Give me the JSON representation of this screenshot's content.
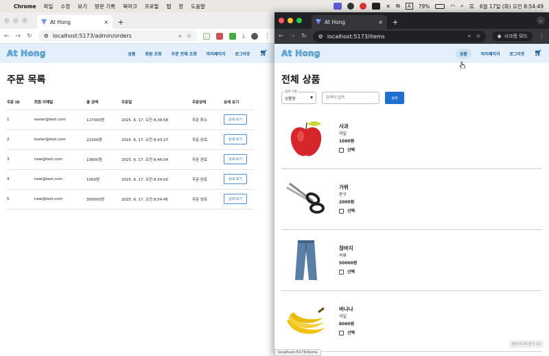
{
  "menubar": {
    "app_name": "Chrome",
    "items": [
      "파일",
      "수정",
      "보기",
      "방문 기록",
      "북마크",
      "프로필",
      "탭",
      "창",
      "도움말"
    ],
    "battery": "79%",
    "datetime": "6월 17일 (화) 오전 8:54:49"
  },
  "left_window": {
    "tab_title": "At Hong",
    "url": "localhost:5173/admin/orders"
  },
  "right_window": {
    "tab_title": "At Hong",
    "url": "localhost:5173/items",
    "incognito_label": "시크릿 모드",
    "status_url": "localhost:5173/items",
    "faded_button": "장바구니에 담기 (0)"
  },
  "site": {
    "logo": "At Hong",
    "nav": [
      "상품",
      "회원 조회",
      "주문 전체 조회",
      "마이페이지",
      "로그아웃"
    ],
    "nav_right": [
      "상품",
      "마이페이지",
      "로그아웃"
    ]
  },
  "orders": {
    "title": "주문 목록",
    "columns": [
      "주문 ID",
      "회원 이메일",
      "총 금액",
      "주문일",
      "주문상태",
      "상세 보기"
    ],
    "detail_label": "상세 보기",
    "rows": [
      {
        "id": "1",
        "email": "tester@test.com",
        "amount": "127000원",
        "date": "2025. 6. 17. 오전 8:39:58",
        "status": "주문 취소"
      },
      {
        "id": "2",
        "email": "tester@test.com",
        "amount": "22200원",
        "date": "2025. 6. 17. 오전 8:43:27",
        "status": "주문 완료"
      },
      {
        "id": "3",
        "email": "new@test.com",
        "amount": "10800원",
        "date": "2025. 6. 17. 오전 8:46:04",
        "status": "주문 완료"
      },
      {
        "id": "4",
        "email": "new@test.com",
        "amount": "1000원",
        "date": "2025. 6. 17. 오전 8:54:00",
        "status": "주문 완료"
      },
      {
        "id": "5",
        "email": "new@test.com",
        "amount": "350000원",
        "date": "2025. 6. 17. 오전 8:54:45",
        "status": "주문 완료"
      }
    ]
  },
  "items": {
    "title": "전체 상품",
    "search_criteria_label": "검색 기준",
    "search_criteria_value": "상품명",
    "search_placeholder": "검색어 입력",
    "search_button": "검색",
    "select_label": "선택",
    "list": [
      {
        "name": "사과",
        "category": "과일",
        "price": "1000원",
        "icon": "apple"
      },
      {
        "name": "가위",
        "category": "문구",
        "price": "2000원",
        "icon": "scissors"
      },
      {
        "name": "청바지",
        "category": "의류",
        "price": "50000원",
        "icon": "jeans"
      },
      {
        "name": "바나나",
        "category": "과일",
        "price": "8000원",
        "icon": "banana"
      }
    ]
  }
}
